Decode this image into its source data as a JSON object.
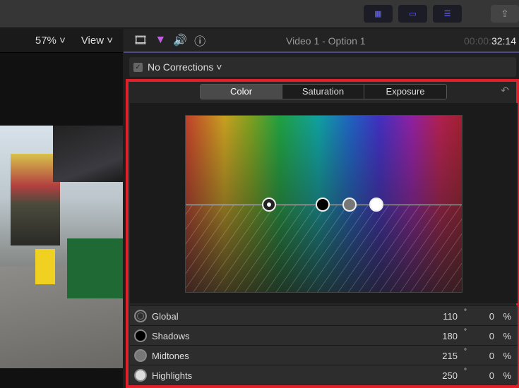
{
  "toolbar": {
    "browser_icon": "grid-icon",
    "timeline_icon": "timeline-icon",
    "inspector_icon": "sliders-icon",
    "share_icon": "share-icon"
  },
  "viewer": {
    "zoom": "57% ˅",
    "view": "View ˅"
  },
  "inspector": {
    "title": "Video 1 - Option 1",
    "timecode_dim": "00:00:",
    "timecode": "32:14",
    "corrections": "No Corrections ˅"
  },
  "color_board": {
    "tabs": [
      "Color",
      "Saturation",
      "Exposure"
    ],
    "active_tab": "Color",
    "rows": [
      {
        "label": "Global",
        "angle": "110",
        "deg": "°",
        "value": "0",
        "unit": "%",
        "puck_color": "#2e2e2e"
      },
      {
        "label": "Shadows",
        "angle": "180",
        "deg": "°",
        "value": "0",
        "unit": "%",
        "puck_color": "#000000"
      },
      {
        "label": "Midtones",
        "angle": "215",
        "deg": "°",
        "value": "0",
        "unit": "%",
        "puck_color": "#777777"
      },
      {
        "label": "Highlights",
        "angle": "250",
        "deg": "°",
        "value": "0",
        "unit": "%",
        "puck_color": "#e0e0e0"
      }
    ]
  },
  "accent": "#e0202a"
}
